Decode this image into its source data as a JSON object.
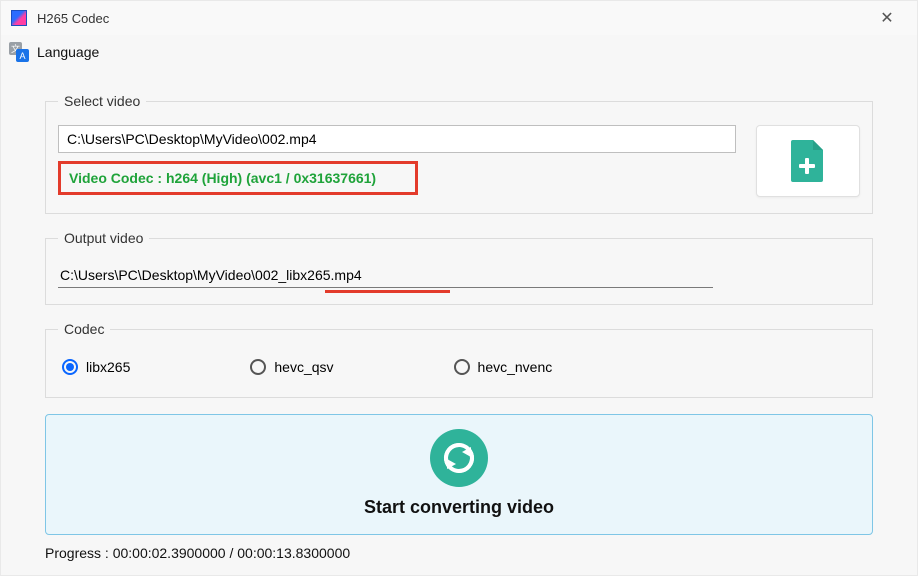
{
  "window": {
    "title": "H265 Codec"
  },
  "menubar": {
    "language": "Language"
  },
  "select_video": {
    "legend": "Select video",
    "path": "C:\\Users\\PC\\Desktop\\MyVideo\\002.mp4",
    "codec_info": "Video Codec : h264 (High) (avc1 / 0x31637661)"
  },
  "output_video": {
    "legend": "Output video",
    "path": "C:\\Users\\PC\\Desktop\\MyVideo\\002_libx265.mp4"
  },
  "codec": {
    "legend": "Codec",
    "options": {
      "opt0": "libx265",
      "opt1": "hevc_qsv",
      "opt2": "hevc_nvenc"
    },
    "selected_index": 0
  },
  "convert": {
    "label": "Start converting video"
  },
  "progress": {
    "text": "Progress : 00:00:02.3900000 / 00:00:13.8300000"
  },
  "colors": {
    "accent_green_btn": "#2fb39a",
    "accent_blue": "#0a66ff",
    "highlight_red": "#e33b2b",
    "codec_text_green": "#1fa33a",
    "convert_bg": "#eaf6fb",
    "convert_border": "#7fc6e6"
  }
}
